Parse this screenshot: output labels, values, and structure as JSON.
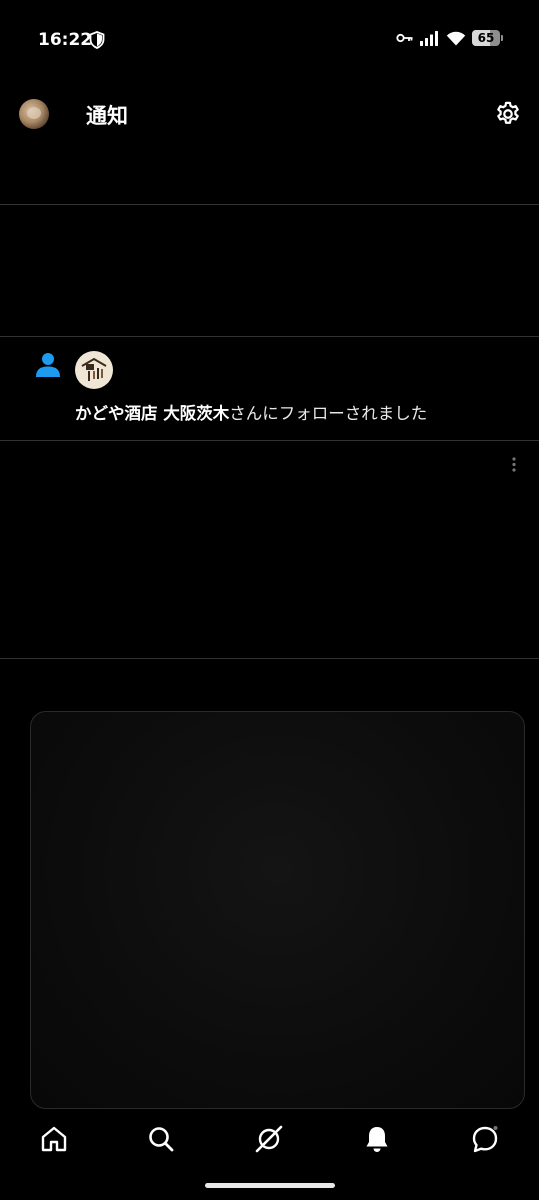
{
  "status_bar": {
    "time": "16:22",
    "battery": "65",
    "battery_level": 0.65,
    "icons": [
      "shield-icon",
      "key-icon",
      "signal-icon",
      "wifi-icon",
      "battery-icon"
    ]
  },
  "header": {
    "title": "通知",
    "avatar_icon": "profile-avatar",
    "settings_icon": "gear-icon"
  },
  "notification": {
    "type_icon": "person-icon",
    "type_icon_color": "#1d9bf0",
    "account_avatar": "kadoya-logo",
    "account_name": "かどや酒店 大阪茨木",
    "message": "さんにフォローされました"
  },
  "bottom_nav": {
    "items": [
      "home-icon",
      "search-icon",
      "grok-icon",
      "bell-icon",
      "messages-icon"
    ],
    "active": "bell-icon"
  },
  "colors": {
    "background": "#000000",
    "divider": "#2f3336",
    "text": "#e7e9ea",
    "accent": "#1d9bf0"
  }
}
